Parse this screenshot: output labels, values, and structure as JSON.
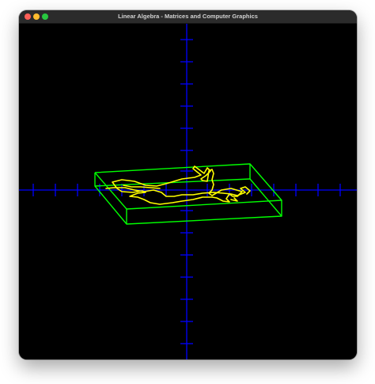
{
  "window": {
    "title": "Linear Algebra - Matrices and Computer Graphics"
  },
  "colors": {
    "background": "#000000",
    "axes": "#0000ff",
    "bounding_box": "#00ff00",
    "figure": "#ffff00",
    "traffic_close": "#ff5f57",
    "traffic_minimize": "#febc2e",
    "traffic_zoom": "#28c840"
  },
  "icons": {
    "close": "close-icon",
    "minimize": "minimize-icon",
    "zoom": "zoom-icon"
  }
}
